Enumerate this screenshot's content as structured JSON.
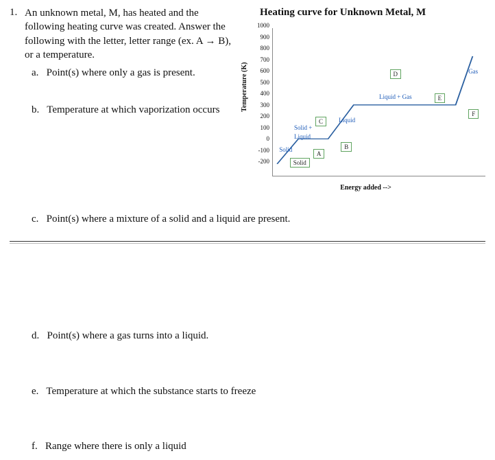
{
  "question": {
    "number": "1.",
    "stem": "An unknown metal, M, has heated and the following heating curve was created. Answer the following with the letter, letter range (ex. A → B), or a temperature.",
    "parts": {
      "a": "Point(s) where only a gas is present.",
      "b": "Temperature at which vaporization occurs",
      "c": "Point(s) where a mixture of a solid and a liquid are present.",
      "d": "Point(s) where a gas turns into a liquid.",
      "e": "Temperature at which the substance starts to freeze",
      "f": "Range where there is only a liquid"
    },
    "letters": {
      "a": "a.",
      "b": "b.",
      "c": "c.",
      "d": "d.",
      "e": "e.",
      "f": "f."
    }
  },
  "chart_data": {
    "type": "line",
    "title": "Heating curve for Unknown Metal, M",
    "ylabel": "Temperature (K)",
    "xlabel": "Energy added -->",
    "ylim": [
      -200,
      1000
    ],
    "yticks": [
      "1000",
      "900",
      "800",
      "700",
      "600",
      "500",
      "400",
      "300",
      "200",
      "100",
      "0",
      "-100",
      "-200"
    ],
    "series": [
      {
        "name": "curve",
        "points_pct": [
          [
            2,
            92
          ],
          [
            12,
            75
          ],
          [
            26,
            75
          ],
          [
            38,
            52
          ],
          [
            86,
            52
          ],
          [
            94,
            19
          ]
        ]
      }
    ],
    "segment_labels": {
      "solid_left": "Solid",
      "solid_liquid": "Solid + Liquid",
      "liquid": "Liquid",
      "liquid_gas": "Liquid + Gas",
      "gas": "Gas"
    },
    "point_labels": {
      "A": "A",
      "B": "B",
      "C": "C",
      "D": "D",
      "E": "E",
      "F": "F",
      "solid_anchor": "Solid"
    }
  }
}
